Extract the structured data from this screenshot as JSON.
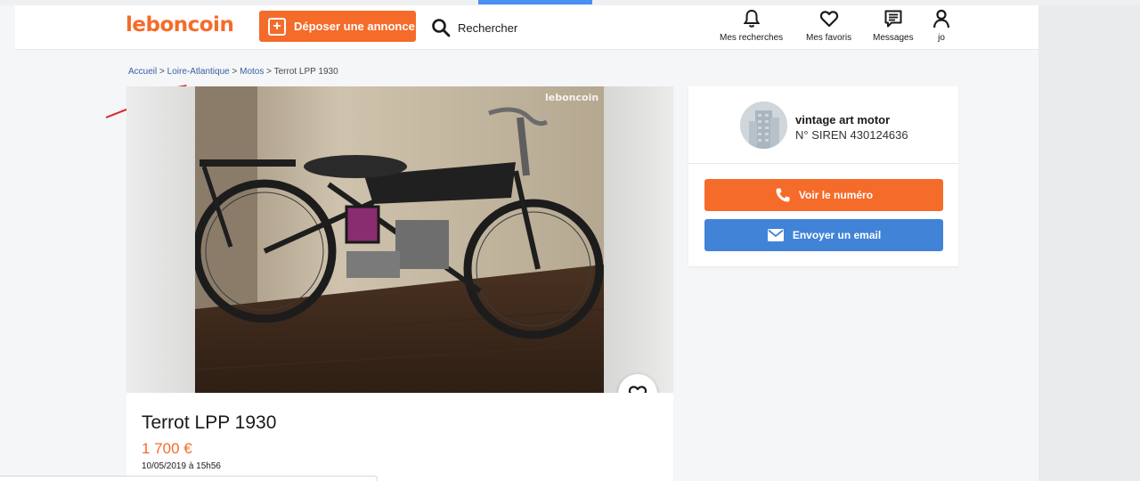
{
  "header": {
    "logo": "leboncoin",
    "post_label": "Déposer une annonce",
    "search_label": "Rechercher",
    "nav": [
      {
        "label": "Mes recherches",
        "icon": "bell-icon"
      },
      {
        "label": "Mes favoris",
        "icon": "heart-icon"
      },
      {
        "label": "Messages",
        "icon": "message-icon"
      },
      {
        "label": "jo",
        "icon": "user-icon"
      }
    ]
  },
  "breadcrumb": {
    "items": [
      "Accueil",
      "Loire-Atlantique",
      "Motos",
      "Terrot LPP 1930"
    ],
    "separator": ">"
  },
  "gallery": {
    "watermark": "leboncoin"
  },
  "ad": {
    "title": "Terrot LPP 1930",
    "price": "1 700 €",
    "date": "10/05/2019 à 15h56"
  },
  "seller": {
    "name": "vintage art motor",
    "siren": "N° SIREN 430124636",
    "phone_label": "Voir le numéro",
    "email_label": "Envoyer un email"
  },
  "colors": {
    "brand_orange": "#f56b2a",
    "email_blue": "#4183d7",
    "annotation_red": "#d8262a"
  }
}
